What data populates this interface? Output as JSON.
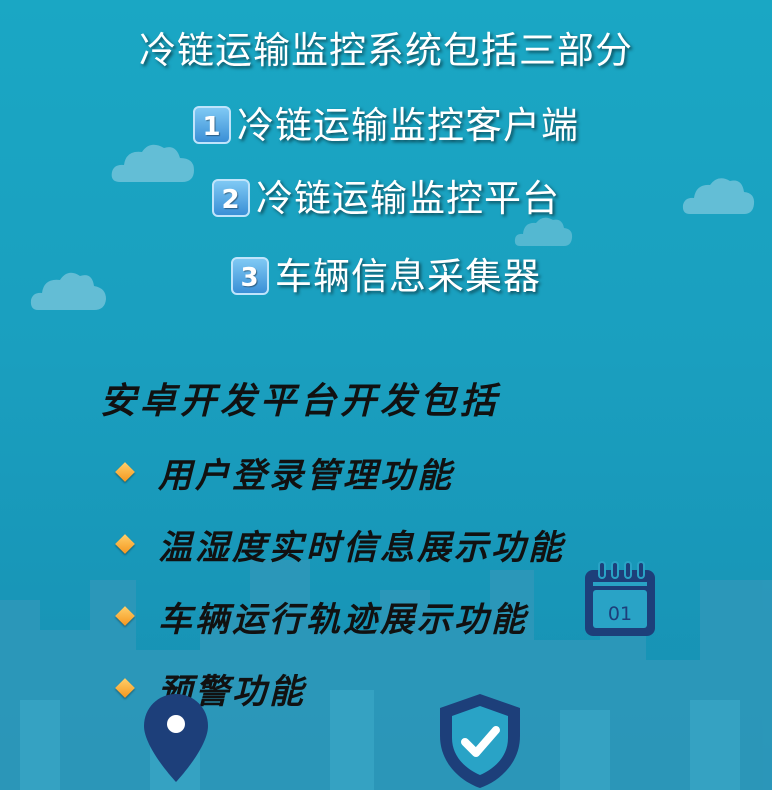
{
  "title": "冷链运输监控系统包括三部分",
  "components": [
    {
      "num": "1",
      "label": "冷链运输监控客户端"
    },
    {
      "num": "2",
      "label": "冷链运输监控平台"
    },
    {
      "num": "3",
      "label": "车辆信息采集器"
    }
  ],
  "android": {
    "heading": "安卓开发平台开发包括",
    "features": [
      "用户登录管理功能",
      "温湿度实时信息展示功能",
      "车辆运行轨迹展示功能",
      "预警功能"
    ]
  },
  "calendar": {
    "day": "01"
  },
  "colors": {
    "background": "#1aa7c4",
    "skyline": "#2e94b6",
    "icon_navy": "#1d3f7a",
    "bullet_orange": "#f5961f"
  },
  "icons": [
    "cloud-icon",
    "calendar-icon",
    "location-pin-icon",
    "shield-check-icon"
  ]
}
